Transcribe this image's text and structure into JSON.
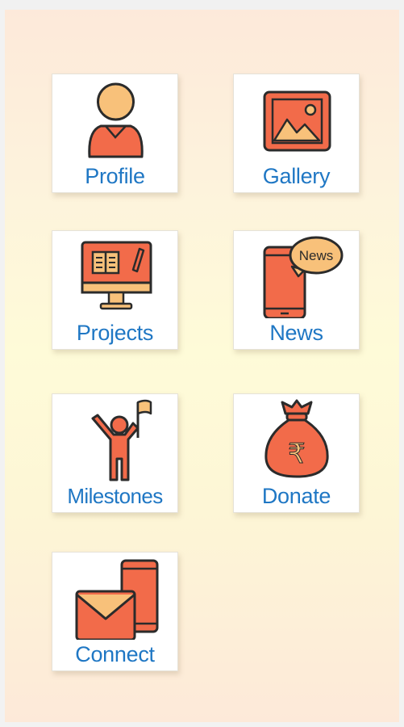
{
  "colors": {
    "accent_text": "#1f77c4",
    "icon_fill": "#f26b4a",
    "icon_secondary": "#f8c17a",
    "outline": "#2b2b2b"
  },
  "menu": {
    "items": [
      {
        "label": "Profile",
        "icon": "person-icon"
      },
      {
        "label": "Gallery",
        "icon": "image-icon"
      },
      {
        "label": "Projects",
        "icon": "monitor-book-icon"
      },
      {
        "label": "News",
        "icon": "phone-news-icon",
        "badge": "News"
      },
      {
        "label": "Milestones",
        "icon": "person-flag-icon"
      },
      {
        "label": "Donate",
        "icon": "rupee-bag-icon",
        "symbol": "₹"
      },
      {
        "label": "Connect",
        "icon": "mail-phone-icon"
      }
    ]
  }
}
